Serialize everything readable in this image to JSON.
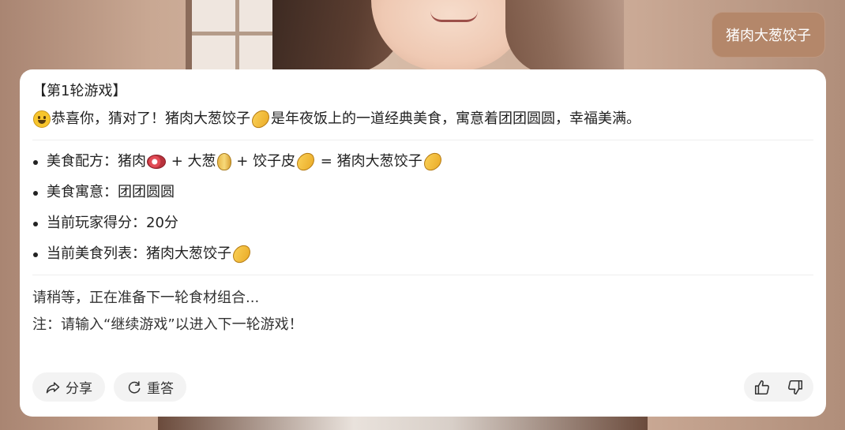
{
  "user_message": "猪肉大葱饺子",
  "reply": {
    "title": "【第1轮游戏】",
    "congrats": {
      "part1": "恭喜你，猜对了！猪肉大葱饺子",
      "part2": "是年夜饭上的一道经典美食，寓意着团团圆圆，幸福美满。"
    },
    "bullets": {
      "recipe": {
        "prefix": "美食配方：猪肉",
        "plus_onion": " + 大葱",
        "plus_wrapper": " + 饺子皮",
        "equals": " = 猪肉大葱饺子"
      },
      "meaning": "美食寓意：团团圆圆",
      "score": "当前玩家得分：20分",
      "food_list": "当前美食列表：猪肉大葱饺子"
    },
    "wait_text": "请稍等，正在准备下一轮食材组合...",
    "note_text": "注：请输入“继续游戏”以进入下一轮游戏！"
  },
  "actions": {
    "share_label": "分享",
    "regenerate_label": "重答"
  },
  "icons": {
    "smile": "grinning-face-emoji",
    "dumpling": "dumpling-emoji",
    "meat": "meat-emoji",
    "onion": "onion-emoji",
    "share": "share-icon",
    "regenerate": "refresh-icon",
    "like": "thumbs-up-icon",
    "dislike": "thumbs-down-icon"
  },
  "colors": {
    "user_bubble": "#b4876a",
    "card": "#ffffff",
    "pill": "#f3f3f3"
  }
}
